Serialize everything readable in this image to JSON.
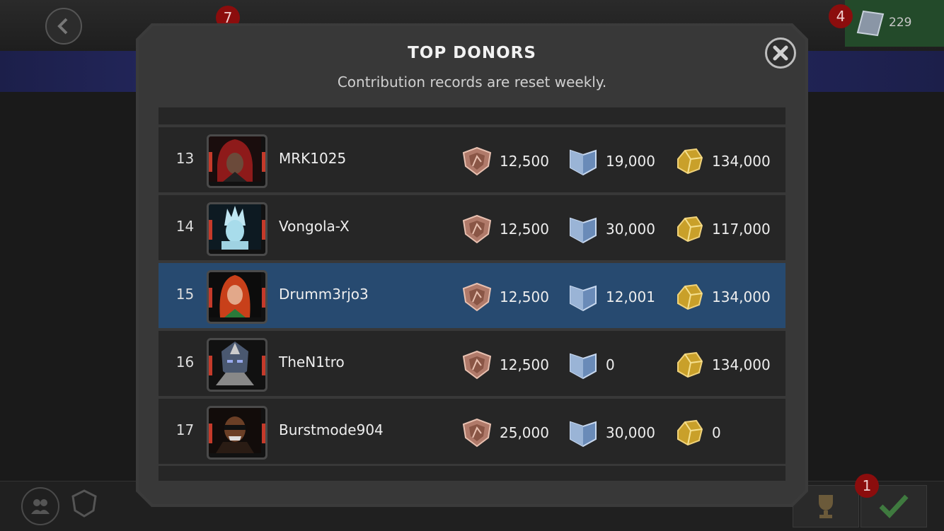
{
  "background": {
    "nav_badge_count": "7",
    "alert_badge_count": "4",
    "currency_value": "229",
    "bottom_badge_count": "1"
  },
  "modal": {
    "title": "TOP DONORS",
    "subtitle": "Contribution records are reset weekly."
  },
  "rows": [
    {
      "rank": "13",
      "name": "MRK1025",
      "shield": "12,500",
      "silver": "19,000",
      "gold": "134,000",
      "highlight": false,
      "portrait": "red-hooded-hero"
    },
    {
      "rank": "14",
      "name": "Vongola-X",
      "shield": "12,500",
      "silver": "30,000",
      "gold": "117,000",
      "highlight": false,
      "portrait": "ice-hero"
    },
    {
      "rank": "15",
      "name": "Drumm3rjo3",
      "shield": "12,500",
      "silver": "12,001",
      "gold": "134,000",
      "highlight": true,
      "portrait": "red-haired-heroine"
    },
    {
      "rank": "16",
      "name": "TheN1tro",
      "shield": "12,500",
      "silver": "0",
      "gold": "134,000",
      "highlight": false,
      "portrait": "armored-villain"
    },
    {
      "rank": "17",
      "name": "Burstmode904",
      "shield": "25,000",
      "silver": "30,000",
      "gold": "0",
      "highlight": false,
      "portrait": "sunglasses-hero"
    }
  ],
  "colors": {
    "highlight_row": "#274a70",
    "row_bg": "#262626",
    "modal_bg": "#383838"
  }
}
